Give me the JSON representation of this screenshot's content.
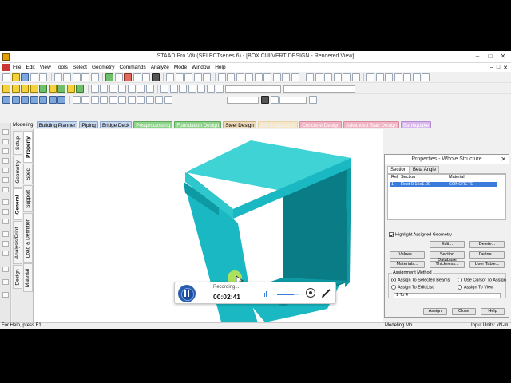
{
  "window": {
    "title": "STAAD.Pro V8i (SELECTseries 6) - [BOX CULVERT DESIGN - Rendered View]",
    "controls": [
      "–",
      "□",
      "✕"
    ]
  },
  "menu": [
    "File",
    "Edit",
    "View",
    "Tools",
    "Select",
    "Geometry",
    "Commands",
    "Analyze",
    "Mode",
    "Window",
    "Help"
  ],
  "page_tabs": [
    {
      "label": "Modeling",
      "style": "plain"
    },
    {
      "label": "Building Planner",
      "style": "blue"
    },
    {
      "label": "Piping",
      "style": "blue"
    },
    {
      "label": "Bridge Deck",
      "style": "blue"
    },
    {
      "label": "Postprocessing",
      "style": "green"
    },
    {
      "label": "Foundation Design",
      "style": "green"
    },
    {
      "label": "Steel Design",
      "style": "tan"
    },
    {
      "label": "Job Preparation",
      "style": "faded"
    },
    {
      "label": "Concrete Design",
      "style": "pink"
    },
    {
      "label": "Advanced Slab Design",
      "style": "pink"
    },
    {
      "label": "Earthquake",
      "style": "violet"
    }
  ],
  "side_tabs": {
    "outer": [
      "Setup",
      "Geometry",
      "General",
      "Analysis/Print",
      "Design"
    ],
    "inner": [
      "Property",
      "Spec",
      "Support",
      "Load & Definition",
      "Material"
    ],
    "active_outer": "General",
    "active_inner": "Property"
  },
  "properties_panel": {
    "title": "Properties - Whole Structure",
    "close_glyph": "✕",
    "tabs": [
      "Section",
      "Beta Angle"
    ],
    "columns": [
      "Ref",
      "Section",
      "Material"
    ],
    "rows": [
      {
        "ref": "1",
        "section": "Rect 0.15x1.00",
        "material": "CONCRETE"
      }
    ],
    "highlight_label": "Highlight Assigned Geometry",
    "highlight_checked": true,
    "buttons": {
      "edit": "Edit...",
      "delete": "Delete...",
      "values": "Values...",
      "section_database": "Section Database",
      "define": "Define...",
      "materials": "Materials...",
      "thickness": "Thickness...",
      "user_table": "User Table..."
    },
    "assignment_method_label": "Assignment Method",
    "assignment_options": {
      "to_selected_beams": "Assign To Selected Beams",
      "use_cursor": "Use Cursor To Assign",
      "to_edit_list": "Assign To Edit List",
      "to_view": "Assign To View"
    },
    "assignment_selected": "to_selected_beams",
    "edit_list_value": "1 To 4",
    "footer_buttons": {
      "assign": "Assign",
      "close": "Close",
      "help": "Help"
    }
  },
  "recorder": {
    "status": "Recording...",
    "time": "00:02:41",
    "volume_fraction": 0.75,
    "icons": [
      "pause-icon",
      "volume-icon",
      "webcam-icon",
      "pen-icon"
    ]
  },
  "statusbar": {
    "help_text": "For Help, press F1",
    "mode_text": "Modeling Mo",
    "units_label": "Input Units:",
    "units_value": "kN-m"
  },
  "colors": {
    "model_top": "#3fd3d6",
    "model_front": "#1ab8c2",
    "model_side": "#0e9aa3",
    "model_inner": "#0a7c85",
    "cursor_highlight": "#c6e84a",
    "selection_blue": "#3a7bdc"
  }
}
